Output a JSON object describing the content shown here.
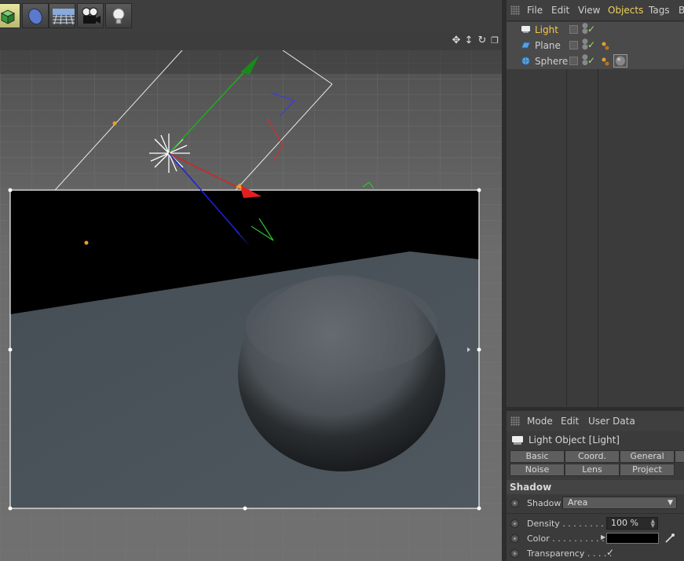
{
  "colors": {
    "accent_menu": "#f0d060",
    "active_object": "#f5c84a",
    "check": "#9be07a",
    "axis_x": "#e03030",
    "axis_y": "#30b030",
    "axis_z": "#3030e0"
  },
  "toolbar": {
    "tools": [
      {
        "icon": "cube-icon",
        "active": true
      },
      {
        "icon": "deformer-icon"
      },
      {
        "icon": "floor-grid-icon"
      },
      {
        "icon": "camera-icon"
      },
      {
        "icon": "light-bulb-icon"
      }
    ]
  },
  "viewport": {
    "nav_icons": [
      "move-view-icon",
      "zoom-view-icon",
      "rotate-view-icon",
      "maximize-view-icon"
    ]
  },
  "object_manager": {
    "menu": [
      "File",
      "Edit",
      "View",
      "Objects",
      "Tags",
      "B"
    ],
    "objects": [
      {
        "name": "Light",
        "icon": "light-object-icon",
        "active": true
      },
      {
        "name": "Plane",
        "icon": "plane-object-icon"
      },
      {
        "name": "Sphere",
        "icon": "sphere-object-icon"
      }
    ]
  },
  "attribute_manager": {
    "menu": [
      "Mode",
      "Edit",
      "User Data"
    ],
    "title": "Light Object [Light]",
    "tabs_row1": [
      "Basic",
      "Coord.",
      "General"
    ],
    "tabs_row2": [
      "Noise",
      "Lens",
      "Project"
    ],
    "section": "Shadow",
    "shadow_label": "Shadow",
    "shadow_value": "Area",
    "density_label": "Density . . . . . . . . . .",
    "density_value": "100 %",
    "color_label": "Color . . . . . . . . . .",
    "transparency_label": "Transparency . . . . .",
    "transparency_check": "✓"
  }
}
